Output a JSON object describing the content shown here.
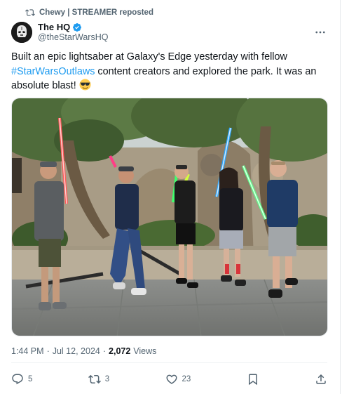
{
  "repost": {
    "label": "Chewy | STREAMER reposted"
  },
  "author": {
    "name": "The HQ",
    "handle": "@theStarWarsHQ",
    "verified_color": "#1d9bf0"
  },
  "tweet": {
    "text_before": "Built an epic lightsaber at Galaxy's Edge yesterday with fellow ",
    "hashtag": "#StarWarsOutlaws",
    "text_after": " content creators and explored the park. It was an absolute blast! ",
    "emoji": "sunglasses-emoji"
  },
  "meta": {
    "time": "1:44 PM",
    "separator": "·",
    "date": "Jul 12, 2024",
    "views_count": "2,072",
    "views_label": "Views"
  },
  "actions": {
    "replies": "5",
    "reposts": "3",
    "likes": "23"
  },
  "colors": {
    "accent": "#1d9bf0",
    "muted": "#536471",
    "text": "#0f1419"
  },
  "icons": [
    "repost-icon",
    "verified-badge-icon",
    "more-icon",
    "reply-icon",
    "retweet-icon",
    "like-icon",
    "bookmark-icon",
    "share-icon"
  ]
}
